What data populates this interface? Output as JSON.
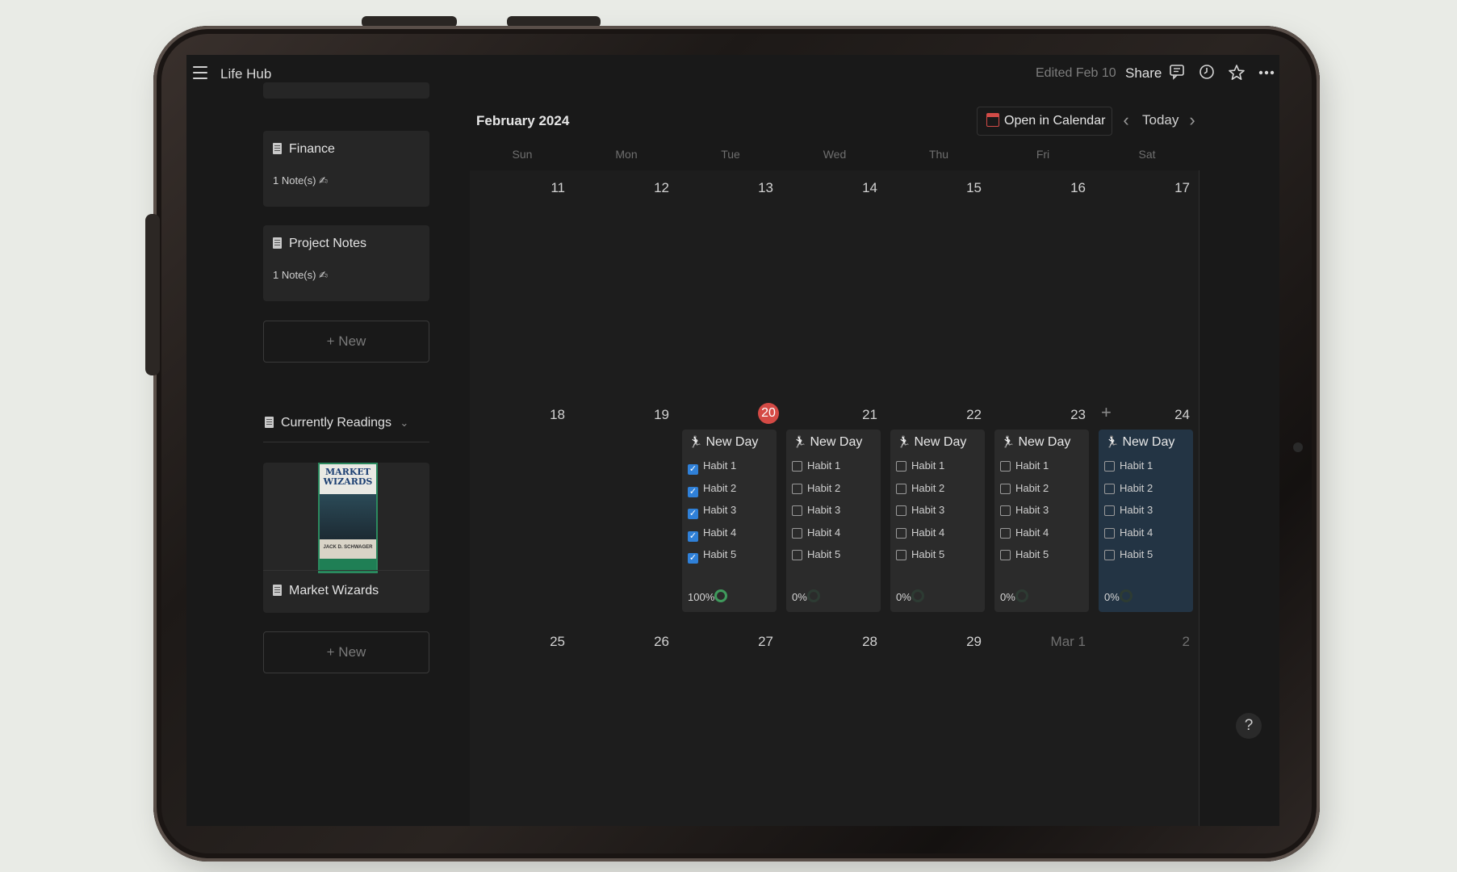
{
  "app": {
    "title": "Life Hub",
    "edited": "Edited Feb 10",
    "share_label": "Share"
  },
  "toolbar_icons": [
    "menu-icon",
    "comment-icon",
    "clock-icon",
    "star-icon",
    "more-icon"
  ],
  "sidebar": {
    "cards": [
      {
        "title": "Finance",
        "meta": "1 Note(s) ✍"
      },
      {
        "title": "Project Notes",
        "meta": "1 Note(s) ✍"
      }
    ],
    "new_label": "+ New",
    "section": {
      "title": "Currently Readings",
      "chevron": "⌄"
    },
    "book": {
      "cover_title": "MARKET WIZARDS",
      "cover_author": "JACK D. SCHWAGER",
      "title": "Market Wizards"
    },
    "new_label_2": "+ New"
  },
  "calendar": {
    "month": "February 2024",
    "open_in_calendar": "Open in Calendar",
    "today_label": "Today",
    "prev": "‹",
    "next": "›",
    "weekdays": [
      "Sun",
      "Mon",
      "Tue",
      "Wed",
      "Thu",
      "Fri",
      "Sat"
    ],
    "weeks": [
      [
        "11",
        "12",
        "13",
        "14",
        "15",
        "16",
        "17"
      ],
      [
        "18",
        "19",
        "20",
        "21",
        "22",
        "23",
        "24"
      ],
      [
        "25",
        "26",
        "27",
        "28",
        "29",
        "Mar 1",
        "2"
      ]
    ],
    "today_date": "20",
    "day_cards": [
      {
        "title": "New Day",
        "habits": [
          {
            "label": "Habit 1",
            "done": true
          },
          {
            "label": "Habit 2",
            "done": true
          },
          {
            "label": "Habit 3",
            "done": true
          },
          {
            "label": "Habit 4",
            "done": true
          },
          {
            "label": "Habit 5",
            "done": true
          }
        ],
        "progress": "100%"
      },
      {
        "title": "New Day",
        "habits": [
          {
            "label": "Habit 1",
            "done": false
          },
          {
            "label": "Habit 2",
            "done": false
          },
          {
            "label": "Habit 3",
            "done": false
          },
          {
            "label": "Habit 4",
            "done": false
          },
          {
            "label": "Habit 5",
            "done": false
          }
        ],
        "progress": "0%"
      },
      {
        "title": "New Day",
        "habits": [
          {
            "label": "Habit 1",
            "done": false
          },
          {
            "label": "Habit 2",
            "done": false
          },
          {
            "label": "Habit 3",
            "done": false
          },
          {
            "label": "Habit 4",
            "done": false
          },
          {
            "label": "Habit 5",
            "done": false
          }
        ],
        "progress": "0%"
      },
      {
        "title": "New Day",
        "habits": [
          {
            "label": "Habit 1",
            "done": false
          },
          {
            "label": "Habit 2",
            "done": false
          },
          {
            "label": "Habit 3",
            "done": false
          },
          {
            "label": "Habit 4",
            "done": false
          },
          {
            "label": "Habit 5",
            "done": false
          }
        ],
        "progress": "0%"
      },
      {
        "title": "New Day",
        "habits": [
          {
            "label": "Habit 1",
            "done": false
          },
          {
            "label": "Habit 2",
            "done": false
          },
          {
            "label": "Habit 3",
            "done": false
          },
          {
            "label": "Habit 4",
            "done": false
          },
          {
            "label": "Habit 5",
            "done": false
          }
        ],
        "progress": "0%"
      }
    ],
    "help_label": "?"
  },
  "colors": {
    "today_badge": "#d44a45",
    "checkbox_on": "#2f80d8",
    "selected_card": "#233444",
    "ring_full": "#3f9a5c"
  }
}
